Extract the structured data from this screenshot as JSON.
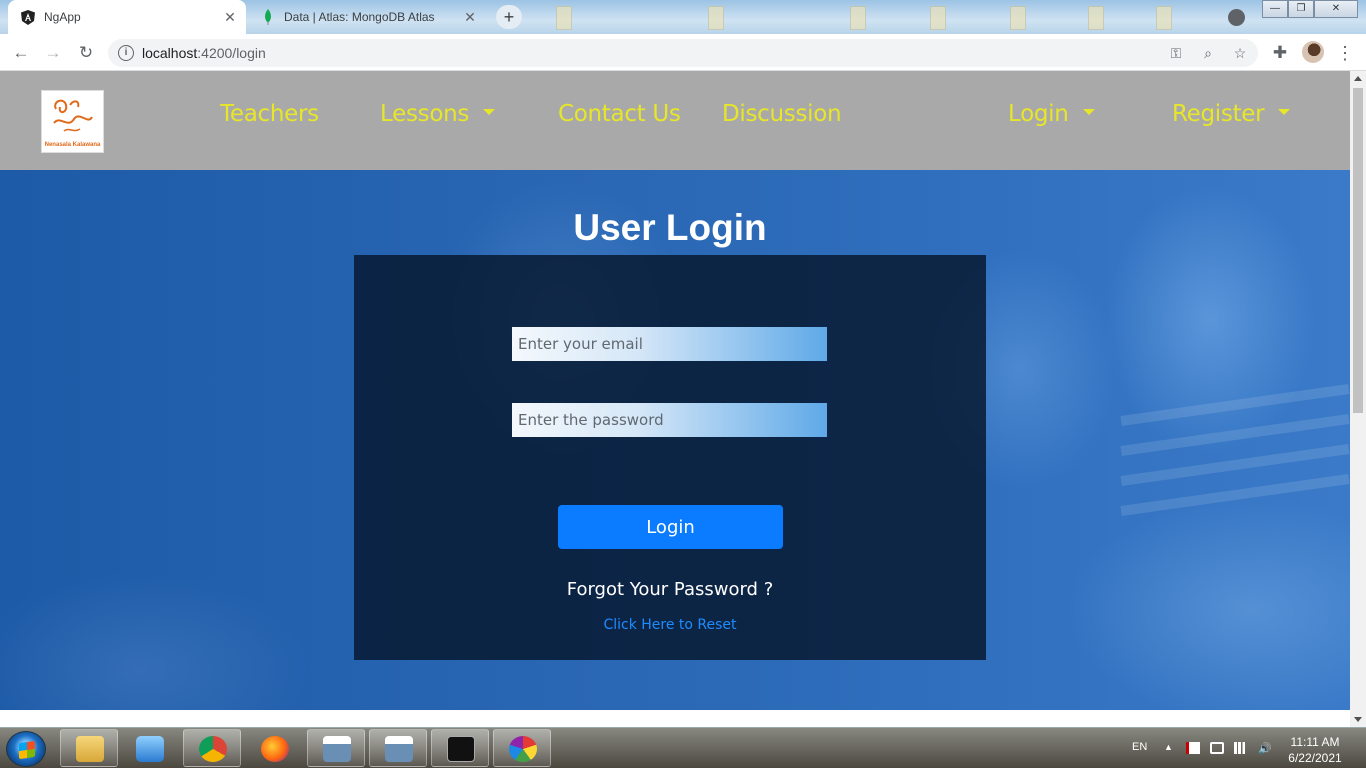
{
  "browser": {
    "tabs": [
      {
        "title": "NgApp",
        "icon": "angular-icon",
        "active": true
      },
      {
        "title": "Data | Atlas: MongoDB Atlas",
        "icon": "mongodb-leaf-icon",
        "active": false
      }
    ],
    "address": {
      "host": "localhost",
      "path": ":4200/login"
    }
  },
  "navbar": {
    "logo_caption": "Nenasala Kalawana",
    "links": {
      "teachers": "Teachers",
      "lessons": "Lessons",
      "contact": "Contact Us",
      "discussion": "Discussion",
      "login": "Login",
      "register": "Register"
    },
    "link_color": "#e7e629",
    "background": "#a9a9a9"
  },
  "login_page": {
    "title": "User Login",
    "email_placeholder": "Enter your email",
    "password_placeholder": "Enter the password",
    "login_button": "Login",
    "forgot_text": "Forgot Your Password ?",
    "reset_link": "Click Here to Reset",
    "button_color": "#0b7cff",
    "link_color": "#1e8bff"
  },
  "taskbar": {
    "language": "EN",
    "time": "11:11 AM",
    "date": "6/22/2021",
    "apps": [
      "explorer-icon",
      "media-player-icon",
      "chrome-icon",
      "firefox-icon",
      "window-icon",
      "window-icon",
      "cmd-icon",
      "picasa-icon"
    ]
  }
}
